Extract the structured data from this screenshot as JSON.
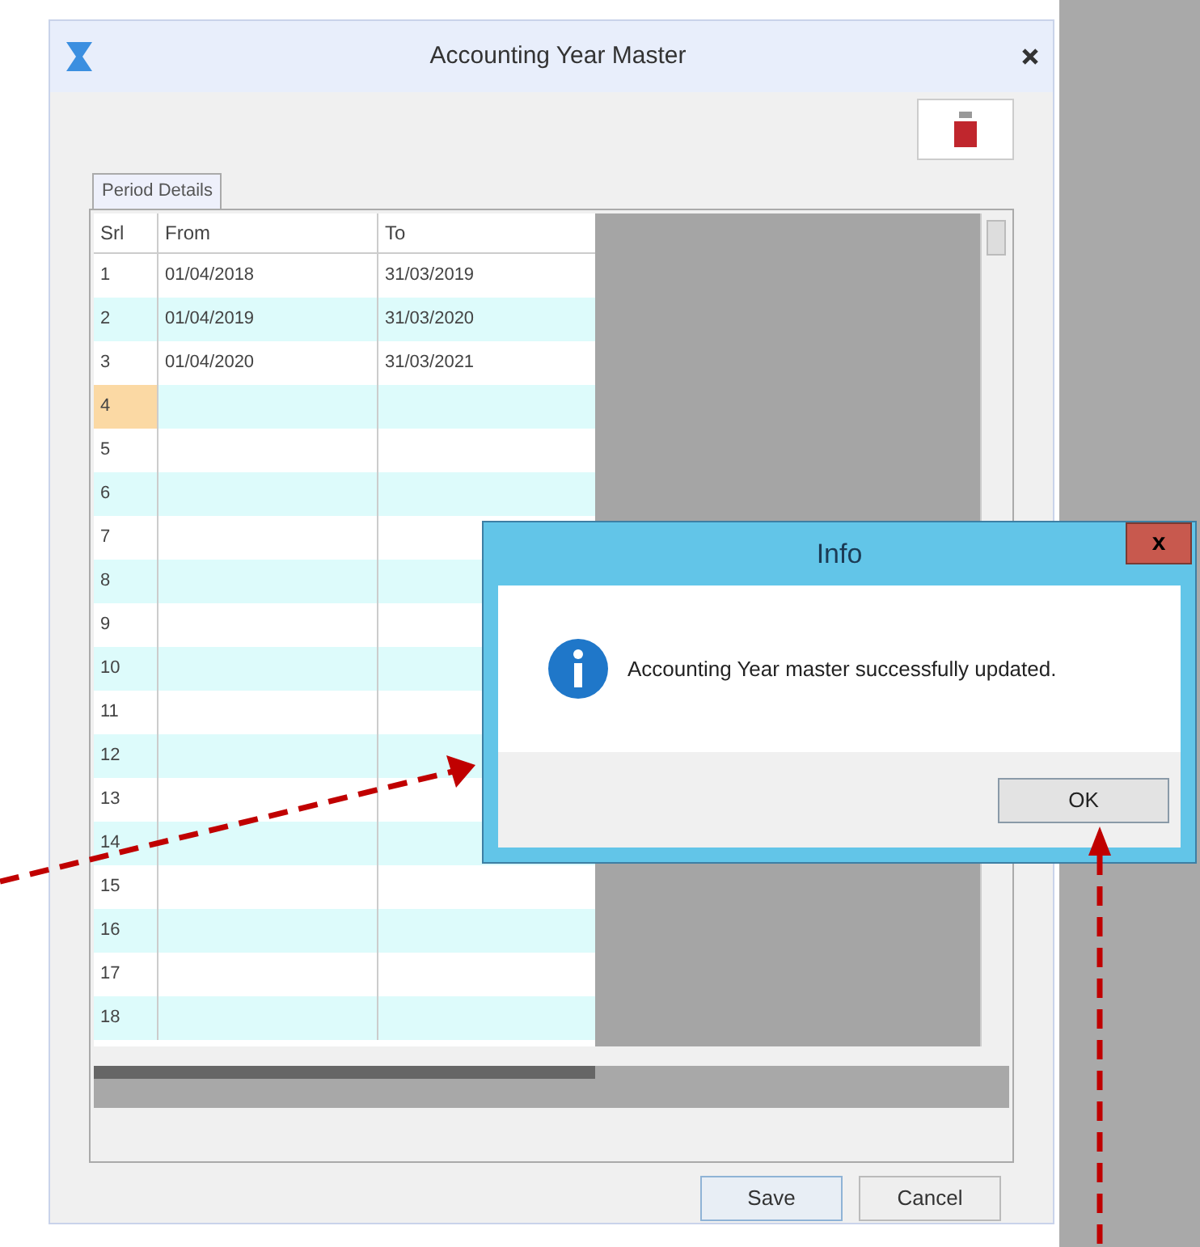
{
  "window": {
    "title": "Accounting Year Master"
  },
  "tabs": [
    {
      "label": "Period Details",
      "selected": true
    }
  ],
  "table": {
    "columns": [
      "Srl",
      "From",
      "To"
    ],
    "rows": [
      {
        "srl": "1",
        "from": "01/04/2018",
        "to": "31/03/2019",
        "selected": false
      },
      {
        "srl": "2",
        "from": "01/04/2019",
        "to": "31/03/2020",
        "selected": false
      },
      {
        "srl": "3",
        "from": "01/04/2020",
        "to": "31/03/2021",
        "selected": false
      },
      {
        "srl": "4",
        "selected": true
      },
      {
        "srl": "5",
        "selected": false
      },
      {
        "srl": "6",
        "selected": false
      },
      {
        "srl": "7",
        "selected": false
      },
      {
        "srl": "8",
        "selected": false
      },
      {
        "srl": "9",
        "selected": false
      },
      {
        "srl": "10",
        "selected": false
      },
      {
        "srl": "11",
        "selected": false
      },
      {
        "srl": "12",
        "selected": false
      },
      {
        "srl": "13",
        "selected": false
      },
      {
        "srl": "14",
        "selected": false
      },
      {
        "srl": "15",
        "selected": false
      },
      {
        "srl": "16",
        "selected": false
      },
      {
        "srl": "17",
        "selected": false
      },
      {
        "srl": "18",
        "selected": false
      }
    ]
  },
  "buttons": [
    "Save",
    "Cancel"
  ],
  "dialog": {
    "title": "Info",
    "close": "x",
    "message": "Accounting Year master successfully updated.",
    "button": "OK"
  }
}
